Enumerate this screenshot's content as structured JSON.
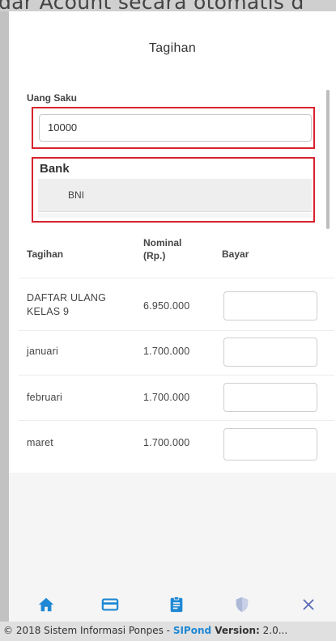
{
  "banner": {
    "text": "dar Acount secara otomatis d"
  },
  "header": {
    "title": "Tagihan"
  },
  "form": {
    "uang_saku_label": "Uang Saku",
    "uang_saku_value": "10000",
    "bank_label": "Bank",
    "bank_selected": "BNI"
  },
  "table": {
    "headers": {
      "tagihan": "Tagihan",
      "nominal_line1": "Nominal",
      "nominal_line2": "(Rp.)",
      "bayar": "Bayar"
    },
    "rows": [
      {
        "name_line1": "DAFTAR ULANG",
        "name_line2": "KELAS 9",
        "nominal": "6.950.000"
      },
      {
        "name_line1": "januari",
        "name_line2": "",
        "nominal": "1.700.000"
      },
      {
        "name_line1": "februari",
        "name_line2": "",
        "nominal": "1.700.000"
      },
      {
        "name_line1": "maret",
        "name_line2": "",
        "nominal": "1.700.000"
      }
    ]
  },
  "nav": {
    "icons": [
      "home-icon",
      "credit-card-icon",
      "clipboard-icon",
      "shield-icon",
      "close-icon"
    ],
    "accent": "#1e88d4"
  },
  "footer": {
    "copyright": "© 2018 Sistem Informasi Ponpes - ",
    "brand": "SIPond",
    "version_label": " Version:",
    "version_value": " 2.0..."
  }
}
